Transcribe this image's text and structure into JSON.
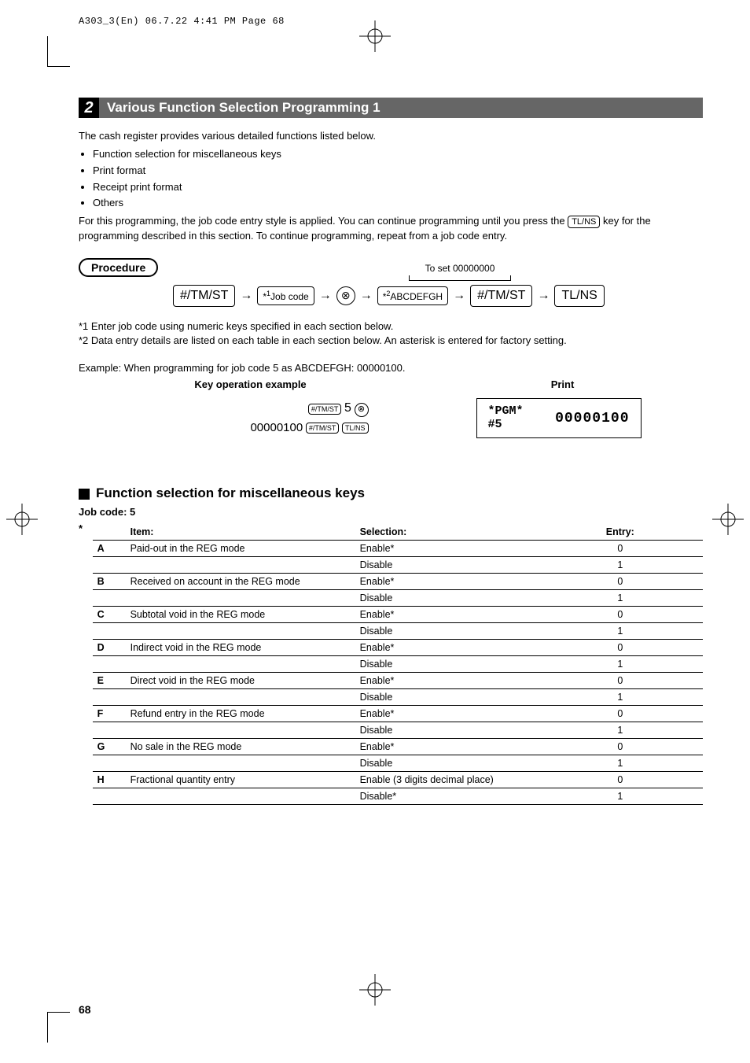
{
  "header": "A303_3(En)  06.7.22 4:41 PM  Page 68",
  "section": {
    "number": "2",
    "title": "Various Function Selection Programming 1"
  },
  "intro": "The cash register provides various detailed functions listed below.",
  "bullets": [
    "Function selection for miscellaneous keys",
    "Print format",
    "Receipt print format",
    "Others"
  ],
  "para2a": "For this programming, the job code entry style is applied.  You can continue programming until you press the",
  "para2_key": "TL/NS",
  "para2b": "key for the programming described in this section.  To continue programming, repeat from a job code entry.",
  "procedure_label": "Procedure",
  "toset": "To set  00000000",
  "flow": {
    "b1": "#/TM/ST",
    "b2_pref": "*",
    "b2_sup": "1",
    "b2": "Job code",
    "circle": "⊗",
    "b3_pref": "*",
    "b3_sup": "2",
    "b3": "ABCDEFGH",
    "b4": "#/TM/ST",
    "b5": "TL/NS"
  },
  "note1": "*1  Enter job code using numeric keys specified in each section below.",
  "note2": "*2  Data entry details are listed on each table in each section below.  An asterisk is entered for factory setting.",
  "example": "Example:  When programming for job code 5 as ABCDEFGH: 00000100.",
  "col_heads": {
    "left": "Key operation example",
    "right": "Print"
  },
  "keyop": {
    "line1_key": "#/TM/ST",
    "line1_num": "5",
    "line1_sym": "⊗",
    "line2_num": "00000100",
    "line2_k1": "#/TM/ST",
    "line2_k2": "TL/NS"
  },
  "print": {
    "l1": "*PGM*",
    "l2": "#5",
    "r": "00000100"
  },
  "subhead": "Function selection for miscellaneous keys",
  "jobcode": "Job code:  5",
  "table": {
    "star": "*",
    "headers": {
      "item": "Item:",
      "selection": "Selection:",
      "entry": "Entry:"
    },
    "rows": [
      {
        "l": "A",
        "item": "Paid-out in the REG mode",
        "sel": "Enable*",
        "ent": "0"
      },
      {
        "l": "",
        "item": "",
        "sel": "Disable",
        "ent": "1"
      },
      {
        "l": "B",
        "item": "Received on account in the REG mode",
        "sel": "Enable*",
        "ent": "0"
      },
      {
        "l": "",
        "item": "",
        "sel": "Disable",
        "ent": "1"
      },
      {
        "l": "C",
        "item": "Subtotal void in the REG mode",
        "sel": "Enable*",
        "ent": "0"
      },
      {
        "l": "",
        "item": "",
        "sel": "Disable",
        "ent": "1"
      },
      {
        "l": "D",
        "item": "Indirect void in the REG mode",
        "sel": "Enable*",
        "ent": "0"
      },
      {
        "l": "",
        "item": "",
        "sel": "Disable",
        "ent": "1"
      },
      {
        "l": "E",
        "item": "Direct void in the REG mode",
        "sel": "Enable*",
        "ent": "0"
      },
      {
        "l": "",
        "item": "",
        "sel": "Disable",
        "ent": "1"
      },
      {
        "l": "F",
        "item": "Refund entry in the REG mode",
        "sel": "Enable*",
        "ent": "0"
      },
      {
        "l": "",
        "item": "",
        "sel": "Disable",
        "ent": "1"
      },
      {
        "l": "G",
        "item": "No sale in the REG mode",
        "sel": "Enable*",
        "ent": "0"
      },
      {
        "l": "",
        "item": "",
        "sel": "Disable",
        "ent": "1"
      },
      {
        "l": "H",
        "item": "Fractional quantity entry",
        "sel": "Enable (3 digits decimal place)",
        "ent": "0"
      },
      {
        "l": "",
        "item": "",
        "sel": "Disable*",
        "ent": "1"
      }
    ]
  },
  "page_num": "68"
}
